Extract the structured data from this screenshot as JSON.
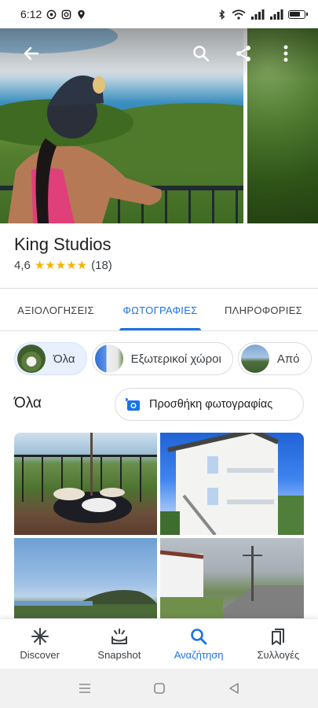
{
  "status_bar": {
    "time": "6:12"
  },
  "place": {
    "name": "King Studios",
    "rating": "4,6",
    "stars": "★★★★★",
    "review_count": "(18)"
  },
  "tabs": [
    {
      "label": "ΑΞΙΟΛΟΓΗΣΕΙΣ"
    },
    {
      "label": "ΦΩΤΟΓΡΑΦΙΕΣ"
    },
    {
      "label": "ΠΛΗΡΟΦΟΡΙΕΣ"
    }
  ],
  "chips": [
    {
      "label": "Όλα"
    },
    {
      "label": "Εξωτερικοί χώροι"
    },
    {
      "label": "Από"
    }
  ],
  "section": {
    "title": "Όλα",
    "add_photo_label": "Προσθήκη φωτογραφίας"
  },
  "bottom_nav": [
    {
      "label": "Discover",
      "icon": "asterisk-icon"
    },
    {
      "label": "Snapshot",
      "icon": "snapshot-icon"
    },
    {
      "label": "Αναζήτηση",
      "icon": "search-icon"
    },
    {
      "label": "Συλλογές",
      "icon": "bookmark-icon"
    }
  ],
  "colors": {
    "accent": "#1a73e8",
    "star": "#f4b400",
    "chip_selected_bg": "#e8f0fe"
  }
}
